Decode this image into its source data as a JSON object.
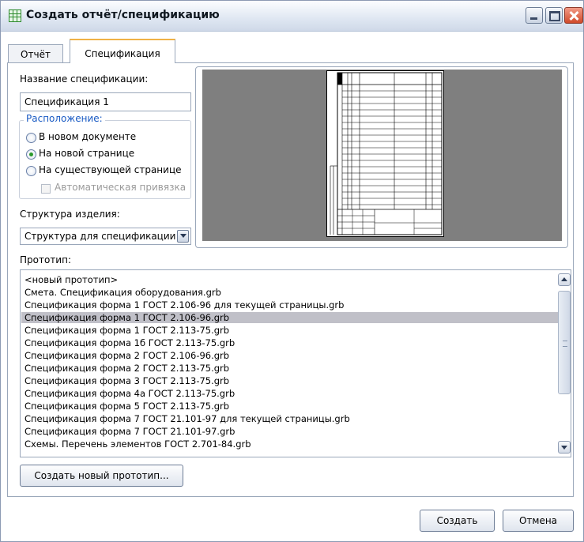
{
  "window": {
    "title": "Создать отчёт/спецификацию"
  },
  "tabs": [
    {
      "label": "Отчёт"
    },
    {
      "label": "Спецификация"
    }
  ],
  "spec": {
    "name_label": "Название спецификации:",
    "name_value": "Спецификация 1",
    "placement_legend": "Расположение:",
    "radios": [
      "В новом документе",
      "На новой странице",
      "На существующей странице"
    ],
    "auto_bind": "Автоматическая привязка",
    "structure_label": "Структура изделия:",
    "structure_value": "Структура для спецификации"
  },
  "prototype": {
    "label": "Прототип:",
    "items": [
      "<новый прототип>",
      "Смета. Спецификация оборудования.grb",
      "Спецификация форма 1 ГОСТ 2.106-96 для текущей страницы.grb",
      "Спецификация форма 1 ГОСТ 2.106-96.grb",
      "Спецификация форма 1 ГОСТ 2.113-75.grb",
      "Спецификация форма 1б ГОСТ 2.113-75.grb",
      "Спецификация форма 2 ГОСТ 2.106-96.grb",
      "Спецификация форма 2 ГОСТ 2.113-75.grb",
      "Спецификация форма 3 ГОСТ 2.113-75.grb",
      "Спецификация форма 4а ГОСТ 2.113-75.grb",
      "Спецификация форма 5 ГОСТ 2.113-75.grb",
      "Спецификация форма 7 ГОСТ 21.101-97 для текущей страницы.grb",
      "Спецификация форма 7 ГОСТ 21.101-97.grb",
      "Схемы. Перечень элементов ГОСТ 2.701-84.grb"
    ],
    "selected_index": 3,
    "new_button": "Создать новый прототип..."
  },
  "footer": {
    "create": "Создать",
    "cancel": "Отмена"
  }
}
